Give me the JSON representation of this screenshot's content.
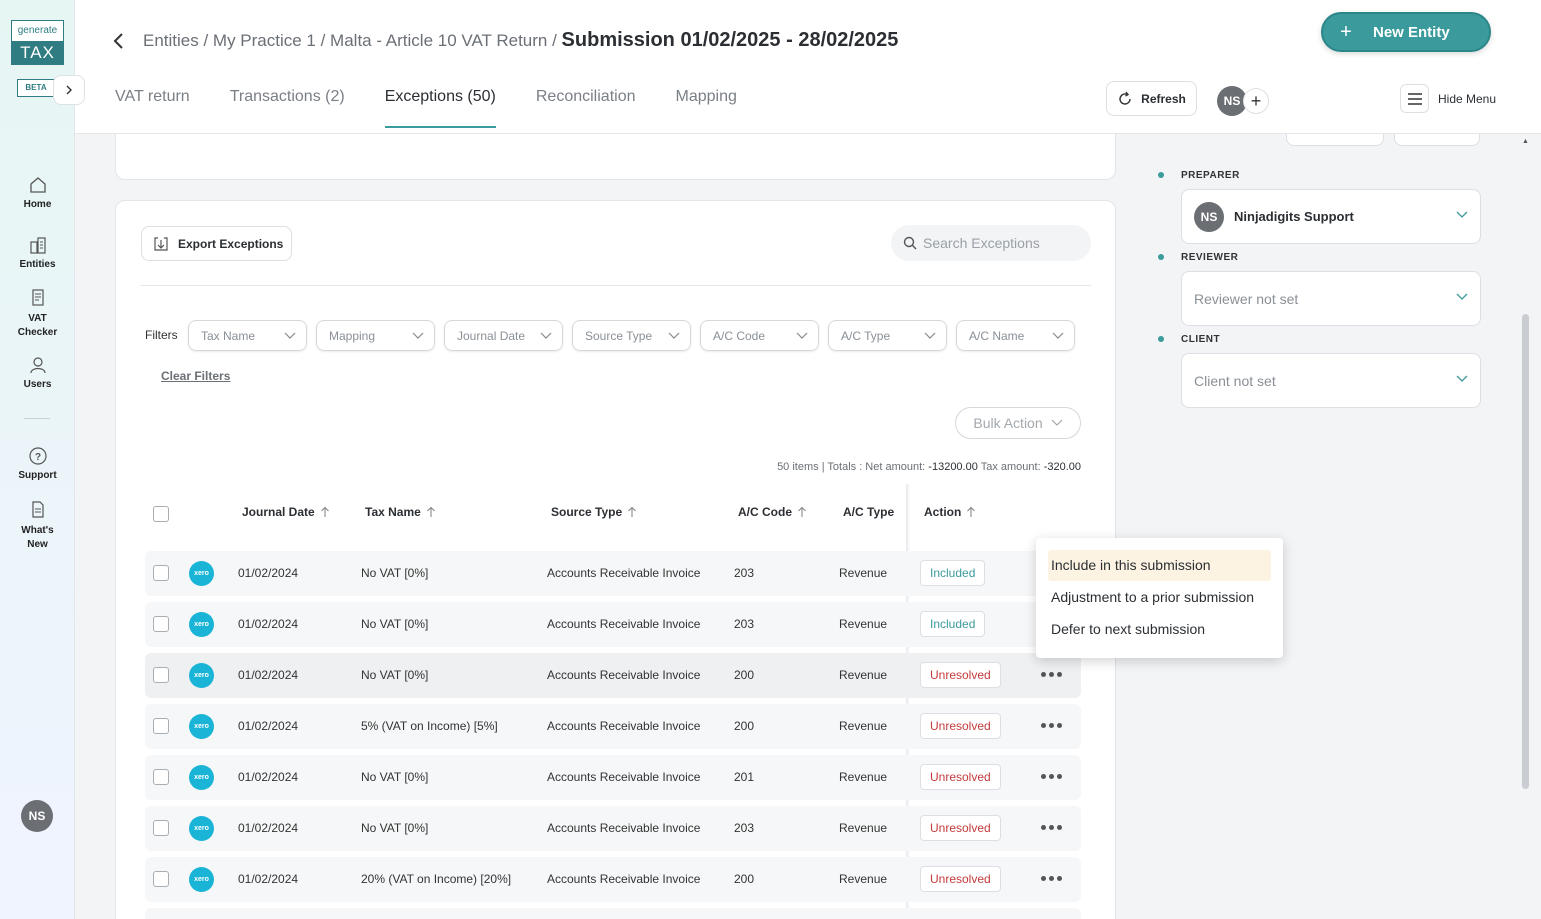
{
  "app": {
    "logo_top": "generate",
    "logo_bottom": "TAX",
    "beta": "BETA"
  },
  "rail": {
    "items": [
      {
        "label": "Home",
        "icon": "home-icon"
      },
      {
        "label": "Entities",
        "icon": "buildings-icon"
      },
      {
        "label": "VAT Checker",
        "icon": "document-icon"
      },
      {
        "label": "Users",
        "icon": "user-icon"
      },
      {
        "label": "Support",
        "icon": "help-icon"
      },
      {
        "label": "What's New",
        "icon": "news-icon"
      }
    ],
    "avatar": "NS"
  },
  "header": {
    "breadcrumb": "Entities / My Practice 1 / Malta - Article 10 VAT Return /",
    "title": "Submission 01/02/2025 - 28/02/2025",
    "new_entity": "New Entity",
    "refresh": "Refresh",
    "avatar": "NS",
    "hide_menu": "Hide Menu",
    "tabs": [
      {
        "label": "VAT return",
        "active": false
      },
      {
        "label": "Transactions (2)",
        "active": false
      },
      {
        "label": "Exceptions (50)",
        "active": true
      },
      {
        "label": "Reconciliation",
        "active": false
      },
      {
        "label": "Mapping",
        "active": false
      }
    ]
  },
  "toolbar": {
    "export": "Export Exceptions",
    "search_placeholder": "Search Exceptions",
    "filters_label": "Filters",
    "filters": [
      "Tax Name",
      "Mapping",
      "Journal Date",
      "Source Type",
      "A/C Code",
      "A/C Type",
      "A/C Name"
    ],
    "clear_filters": "Clear Filters",
    "bulk_action": "Bulk Action",
    "totals_prefix": "50 items | Totals : Net amount: ",
    "net_amount": "-13200.00",
    "tax_label": " Tax amount: ",
    "tax_amount": "-320.00"
  },
  "table": {
    "columns": [
      "Journal Date",
      "Tax Name",
      "Source Type",
      "A/C Code",
      "A/C Type",
      "Action"
    ],
    "rows": [
      {
        "date": "01/02/2024",
        "tax": "No VAT [0%]",
        "source": "Accounts Receivable Invoice",
        "code": "203",
        "type": "Revenue",
        "status": "Included"
      },
      {
        "date": "01/02/2024",
        "tax": "No VAT [0%]",
        "source": "Accounts Receivable Invoice",
        "code": "203",
        "type": "Revenue",
        "status": "Included"
      },
      {
        "date": "01/02/2024",
        "tax": "No VAT [0%]",
        "source": "Accounts Receivable Invoice",
        "code": "200",
        "type": "Revenue",
        "status": "Unresolved"
      },
      {
        "date": "01/02/2024",
        "tax": "5% (VAT on Income) [5%]",
        "source": "Accounts Receivable Invoice",
        "code": "200",
        "type": "Revenue",
        "status": "Unresolved"
      },
      {
        "date": "01/02/2024",
        "tax": "No VAT [0%]",
        "source": "Accounts Receivable Invoice",
        "code": "201",
        "type": "Revenue",
        "status": "Unresolved"
      },
      {
        "date": "01/02/2024",
        "tax": "No VAT [0%]",
        "source": "Accounts Receivable Invoice",
        "code": "203",
        "type": "Revenue",
        "status": "Unresolved"
      },
      {
        "date": "01/02/2024",
        "tax": "20% (VAT on Income) [20%]",
        "source": "Accounts Receivable Invoice",
        "code": "200",
        "type": "Revenue",
        "status": "Unresolved"
      }
    ],
    "source_badge": "xero"
  },
  "action_menu": {
    "items": [
      "Include in this submission",
      "Adjustment to a prior submission",
      "Defer to next submission"
    ]
  },
  "right_panel": {
    "preparer_label": "PREPARER",
    "preparer_avatar": "NS",
    "preparer_name": "Ninjadigits Support",
    "reviewer_label": "REVIEWER",
    "reviewer_value": "Reviewer not set",
    "client_label": "CLIENT",
    "client_value": "Client not set"
  },
  "colors": {
    "accent": "#3b9a9c",
    "unresolved": "#c43b3b",
    "xero": "#1ab4d7"
  }
}
